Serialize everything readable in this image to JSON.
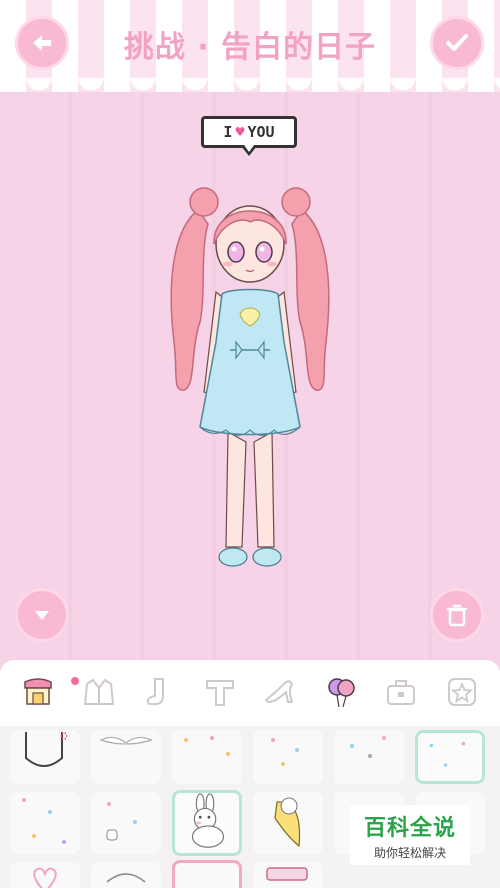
{
  "header": {
    "title": "挑战 · 告白的日子",
    "back_icon": "arrow-left-icon",
    "confirm_icon": "check-icon"
  },
  "stage": {
    "speech_bubble": {
      "prefix": "I",
      "heart": "♥",
      "suffix": "YOU"
    },
    "collapse_icon": "triangle-down-icon",
    "delete_icon": "trash-icon"
  },
  "tabs": [
    {
      "name": "shop-icon",
      "active": true
    },
    {
      "name": "jacket-icon"
    },
    {
      "name": "sock-icon"
    },
    {
      "name": "shirt-icon"
    },
    {
      "name": "high-heel-icon"
    },
    {
      "name": "balloons-icon"
    },
    {
      "name": "bag-icon"
    },
    {
      "name": "star-icon"
    }
  ],
  "watermark": {
    "title": "百科全说",
    "subtitle": "助你轻松解决"
  },
  "colors": {
    "accent_pink": "#f9b9d2",
    "title_pink": "#f2a3c4",
    "mint": "#b7e6d7"
  }
}
